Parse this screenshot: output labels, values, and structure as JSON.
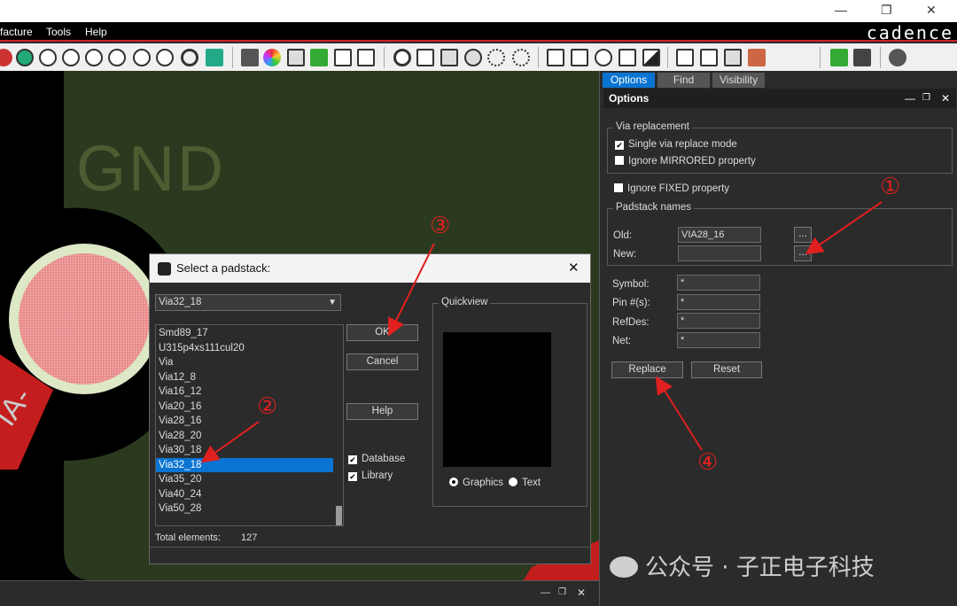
{
  "menu": {
    "items": [
      "facture",
      "Tools",
      "Help"
    ],
    "brand": "cadence"
  },
  "canvas": {
    "net_label": "GND",
    "via_label": "IA-"
  },
  "right_panel": {
    "tabs": [
      "Options",
      "Find",
      "Visibility"
    ],
    "header": "Options",
    "via_replacement": {
      "title": "Via replacement",
      "single_mode": "Single via replace mode",
      "ignore_mirrored": "Ignore MIRRORED property"
    },
    "ignore_fixed": "Ignore FIXED property",
    "padstack": {
      "title": "Padstack names",
      "old_label": "Old:",
      "old_value": "VIA28_16",
      "new_label": "New:",
      "new_value": "",
      "browse": "..."
    },
    "filters": [
      {
        "label": "Symbol:",
        "value": "*"
      },
      {
        "label": "Pin #(s):",
        "value": "*"
      },
      {
        "label": "RefDes:",
        "value": "*"
      },
      {
        "label": "Net:",
        "value": "*"
      }
    ],
    "replace": "Replace",
    "reset": "Reset"
  },
  "dialog": {
    "title": "Select a padstack:",
    "selected": "Via32_18",
    "items": [
      "Smd89_17",
      "U315p4xs111cul20",
      "Via",
      "Via12_8",
      "Via16_12",
      "Via20_16",
      "Via28_16",
      "Via28_20",
      "Via30_18",
      "Via32_18",
      "Via35_20",
      "Via40_24",
      "Via50_28"
    ],
    "ok": "OK",
    "cancel": "Cancel",
    "help": "Help",
    "database": "Database",
    "library": "Library",
    "quickview": "Quickview",
    "graphics": "Graphics",
    "text": "Text",
    "total_label": "Total elements:",
    "total_value": "127"
  },
  "annotations": [
    "①",
    "②",
    "③",
    "④"
  ],
  "watermark": "公众号 · 子正电子科技"
}
